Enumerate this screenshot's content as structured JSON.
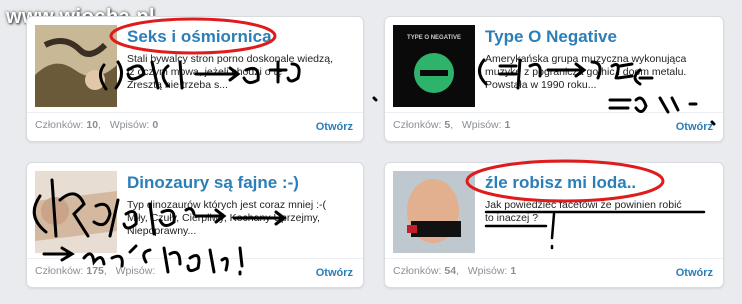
{
  "watermark": "www.wiocha.pl",
  "groups": [
    {
      "title": "Seks i ośmiornica",
      "desc": [
        "Stali bywalcy stron porno doskonale wiedzą,",
        "iż oczym mowa, jeżeli chodzi o tę",
        "Zresztą nie trzeba s..."
      ],
      "members_label": "Członków:",
      "members": "10",
      "posts_label": "Wpisów:",
      "posts": "0",
      "open": "Otwórz"
    },
    {
      "title": "Type O Negative",
      "desc": [
        "Amerykańska grupa muzyczna wykonująca",
        "muzykę z pogranicza gothic i doom metalu.",
        "Powstała w 1990 roku..."
      ],
      "members_label": "Członków:",
      "members": "5",
      "posts_label": "Wpisów:",
      "posts": "1",
      "open": "Otwórz",
      "thumb_text": "TYPE O NEGATIVE"
    },
    {
      "title": "Dinozaury są fajne :-)",
      "desc": [
        "Typ dinozaurów których jest coraz mniej :-(",
        "Miły, Czuły, Cierpliwy, Kochany Uprzejmy,",
        "Niepoprawny..."
      ],
      "members_label": "Członków:",
      "members": "175",
      "posts_label": "Wpisów:",
      "posts": "",
      "open": "Otwórz"
    },
    {
      "title": "źle robisz mi loda..",
      "desc": [
        "Jak powiedzieć facetowi że powinien robić",
        "to inaczej ?"
      ],
      "members_label": "Członków:",
      "members": "54",
      "posts_label": "Wpisów:",
      "posts": "1",
      "open": "Otwórz"
    }
  ],
  "colors": {
    "link": "#2b7fb8",
    "highlight": "#e01b1b",
    "ink": "#000000"
  }
}
